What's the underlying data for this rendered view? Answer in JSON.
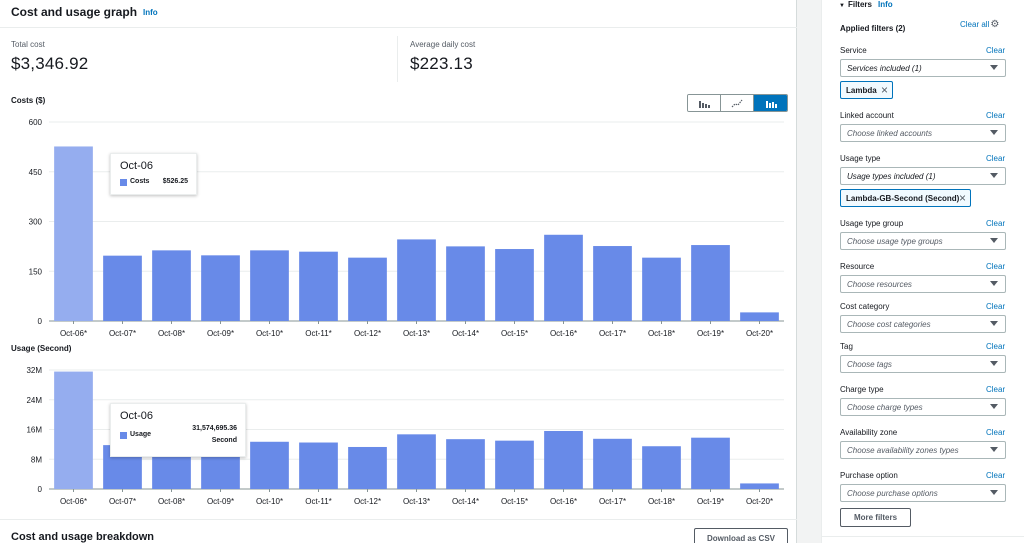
{
  "header": {
    "title": "Cost and usage graph",
    "info": "Info"
  },
  "metrics": {
    "total_cost": {
      "label": "Total cost",
      "value": "$3,346.92"
    },
    "average_daily": {
      "label": "Average daily cost",
      "value": "$223.13"
    }
  },
  "chart_type_buttons": [
    "bar-chart-icon",
    "line-chart-icon",
    "stacked-bar-chart-icon"
  ],
  "chart_data": [
    {
      "type": "bar",
      "title": "Costs ($)",
      "categories": [
        "Oct-06*",
        "Oct-07*",
        "Oct-08*",
        "Oct-09*",
        "Oct-10*",
        "Oct-11*",
        "Oct-12*",
        "Oct-13*",
        "Oct-14*",
        "Oct-15*",
        "Oct-16*",
        "Oct-17*",
        "Oct-18*",
        "Oct-19*",
        "Oct-20*"
      ],
      "series": [
        {
          "name": "Costs",
          "values": [
            526.25,
            197,
            213,
            198,
            213,
            209,
            191,
            246,
            225,
            217,
            260,
            226,
            191,
            229,
            26
          ]
        }
      ],
      "ylim": [
        0,
        600
      ],
      "yticks": [
        "0",
        "150",
        "300",
        "450",
        "600"
      ],
      "ytick_values": [
        0,
        150,
        300,
        450,
        600
      ],
      "highlight_index": 0,
      "tooltip": {
        "title": "Oct-06",
        "series": "Costs",
        "value": "$526.25",
        "unit": ""
      },
      "color": "#688ae8",
      "highlight_color": "#95adef"
    },
    {
      "type": "bar",
      "title": "Usage (Second)",
      "categories": [
        "Oct-06*",
        "Oct-07*",
        "Oct-08*",
        "Oct-09*",
        "Oct-10*",
        "Oct-11*",
        "Oct-12*",
        "Oct-13*",
        "Oct-14*",
        "Oct-15*",
        "Oct-16*",
        "Oct-17*",
        "Oct-18*",
        "Oct-19*",
        "Oct-20*"
      ],
      "series": [
        {
          "name": "Usage",
          "values": [
            31574695.36,
            11800000,
            12300000,
            11500000,
            12700000,
            12500000,
            11300000,
            14700000,
            13400000,
            13000000,
            15600000,
            13500000,
            11500000,
            13800000,
            1500000
          ]
        }
      ],
      "ylim": [
        0,
        32000000
      ],
      "yticks": [
        "0",
        "8M",
        "16M",
        "24M",
        "32M"
      ],
      "ytick_values": [
        0,
        8000000,
        16000000,
        24000000,
        32000000
      ],
      "highlight_index": 0,
      "tooltip": {
        "title": "Oct-06",
        "series": "Usage",
        "value": "31,574,695.36",
        "unit": "Second"
      },
      "color": "#688ae8",
      "highlight_color": "#95adef"
    }
  ],
  "breakdown": {
    "title": "Cost and usage breakdown",
    "download": "Download as CSV"
  },
  "filters": {
    "title": "Filters",
    "info": "Info",
    "applied": "Applied filters (2)",
    "clear_all": "Clear all",
    "clear": "Clear",
    "service": {
      "label": "Service",
      "value": "Services included (1)",
      "token": "Lambda"
    },
    "linked_account": {
      "label": "Linked account",
      "placeholder": "Choose linked accounts"
    },
    "usage_type": {
      "label": "Usage type",
      "value": "Usage types included (1)",
      "token": "Lambda-GB-Second (Second)"
    },
    "usage_type_group": {
      "label": "Usage type group",
      "placeholder": "Choose usage type groups"
    },
    "resource": {
      "label": "Resource",
      "placeholder": "Choose resources"
    },
    "cost_category": {
      "label": "Cost category",
      "placeholder": "Choose cost categories"
    },
    "tag": {
      "label": "Tag",
      "placeholder": "Choose tags"
    },
    "charge_type": {
      "label": "Charge type",
      "placeholder": "Choose charge types"
    },
    "availability_zone": {
      "label": "Availability zone",
      "placeholder": "Choose availability zones types"
    },
    "purchase_option": {
      "label": "Purchase option",
      "placeholder": "Choose purchase options"
    },
    "more_filters": "More filters"
  }
}
